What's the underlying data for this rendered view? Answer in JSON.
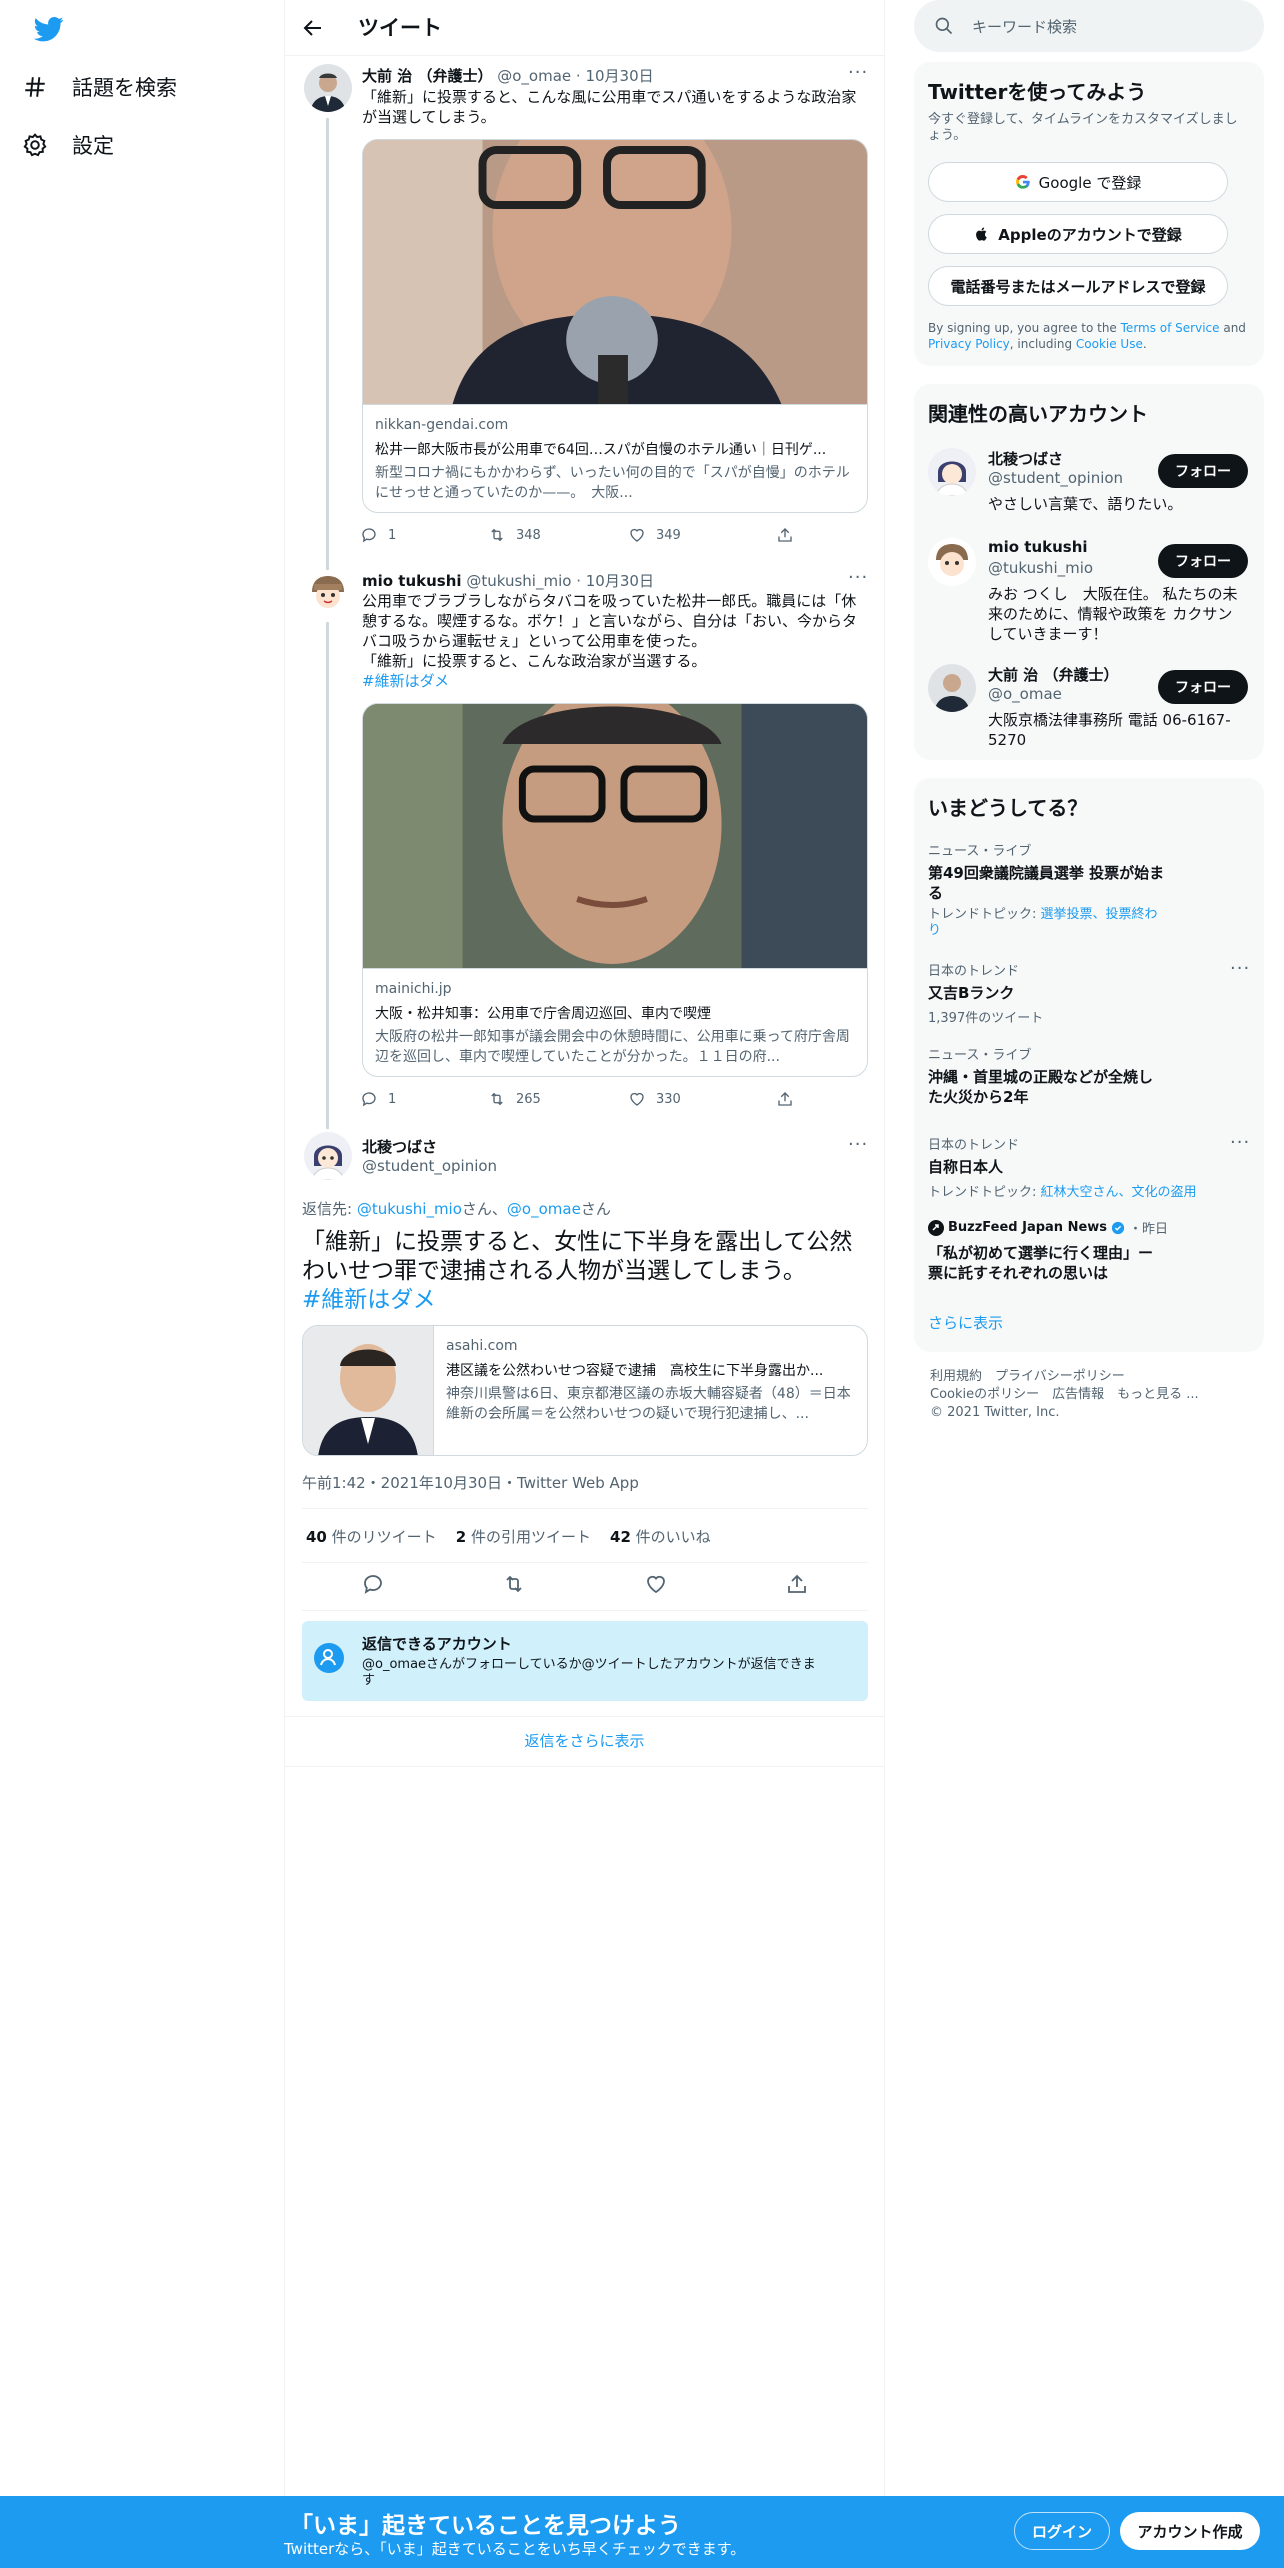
{
  "nav": {
    "explore_label": "話題を検索",
    "settings_label": "設定"
  },
  "header": {
    "title": "ツイート"
  },
  "thread": [
    {
      "name": "大前 治 （弁護士）",
      "handle": "@o_omae",
      "date": "10月30日",
      "text_lines": [
        "「維新」に投票すると、こんな風に公用車でスパ通いをするような政治家",
        "が当選してしまう。"
      ],
      "card_domain": "nikkan-gendai.com",
      "card_title": "松井一郎大阪市長が公用車で64回…スパが自慢のホテル通い｜日刊ゲ...",
      "card_desc": "新型コロナ禍にもかかわらず、いったい何の目的で「スパが自慢」のホテルにせっせと通っていたのか——。　大阪...",
      "replies": "1",
      "retweets": "348",
      "likes": "349"
    },
    {
      "name": "mio tukushi",
      "handle": "@tukushi_mio",
      "date": "10月30日",
      "text_lines": [
        "公用車でブラブラしながらタバコを吸っていた松井一郎氏。職員には「休",
        "憩するな。喫煙するな。ボケ！」と言いながら、自分は「おい、今からタ",
        "バコ吸うから運転せぇ」といって公用車を使った。",
        "「維新」に投票すると、こんな政治家が当選する。"
      ],
      "hashtag": "#維新はダメ",
      "card_domain": "mainichi.jp",
      "card_title": "大阪・松井知事：公用車で庁舎周辺巡回、車内で喫煙",
      "card_desc": "大阪府の松井一郎知事が議会開会中の休憩時間に、公用車に乗って府庁舎周辺を巡回し、車内で喫煙していたことが分かった。１１日の府...",
      "replies": "1",
      "retweets": "265",
      "likes": "330"
    }
  ],
  "main_tweet": {
    "name": "北稜つばさ",
    "handle": "@student_opinion",
    "reply_prefix": "返信先: ",
    "reply_user1": "@tukushi_mio",
    "reply_san1": "さん、",
    "reply_user2": "@o_omae",
    "reply_san2": "さん",
    "text_line1": "「維新」に投票すると、女性に下半身を露出して公然",
    "text_line2": "わいせつ罪で逮捕される人物が当選してしまう。",
    "hashtag": "#維新はダメ",
    "card_domain": "asahi.com",
    "card_title": "港区議を公然わいせつ容疑で逮捕　高校生に下半身露出か...",
    "card_desc": "神奈川県警は6日、東京都港区議の赤坂大輔容疑者（48）＝日本維新の会所属＝を公然わいせつの疑いで現行犯逮捕し、...",
    "timestamp": "午前1:42・2021年10月30日・Twitter Web App",
    "retweet_count": "40",
    "retweet_label": " 件のリツイート",
    "quote_count": "2",
    "quote_label": " 件の引用ツイート",
    "like_count": "42",
    "like_label": " 件のいいね",
    "reply_restrict_title": "返信できるアカウント",
    "reply_restrict_text1": "@o_omaeさんがフォローしているか@ツイートしたアカウントが返信できま",
    "reply_restrict_text2": "す",
    "show_more_replies": "返信をさらに表示"
  },
  "sidebar": {
    "search_placeholder": "キーワード検索",
    "signup": {
      "title": "Twitterを使ってみよう",
      "subtitle1": "今すぐ登録して、タイムラインをカスタマイズしまし",
      "subtitle2": "ょう。",
      "google_btn": "Google で登録",
      "apple_btn": "Appleのアカウントで登録",
      "phone_btn": "電話番号またはメールアドレスで登録",
      "terms_prefix": "By signing up, you agree to the ",
      "terms_link": "Terms of Service",
      "terms_and": " and",
      "privacy_link": "Privacy Policy",
      "terms_including": ", including ",
      "cookie_link": "Cookie Use",
      "terms_end": "."
    },
    "related": {
      "title": "関連性の高いアカウント",
      "follow_label": "フォロー",
      "accounts": [
        {
          "name": "北稜つばさ",
          "handle": "@student_opinion",
          "bio1": "やさしい言葉で、語りたい。",
          "bio2": "",
          "bio3": ""
        },
        {
          "name": "mio tukushi",
          "handle": "@tukushi_mio",
          "bio1": "みお つくし　大阪在住。 私たちの未",
          "bio2": "来のために、情報や政策を カクサン",
          "bio3": "していきまーす！"
        },
        {
          "name": "大前 治 （弁護士）",
          "handle": "@o_omae",
          "bio1": "大阪京橋法律事務所 電話 06-6167-",
          "bio2": "5270",
          "bio3": ""
        }
      ]
    },
    "trends": {
      "title": "いまどうしてる？",
      "items": [
        {
          "meta": "ニュース・ライブ",
          "name1": "第49回衆議院議員選挙 投票が始ま",
          "name2": "る",
          "topic_label": "トレンドトピック: ",
          "topic1": "選挙投票、投票終わ",
          "topic2": "り"
        },
        {
          "meta": "日本のトレンド",
          "name1": "又吉Bランク",
          "count": "1,397件のツイート"
        },
        {
          "meta": "ニュース・ライブ",
          "name1": "沖縄・首里城の正殿などが全焼し",
          "name2": "た火災から2年"
        },
        {
          "meta": "日本のトレンド",
          "name1": "自称日本人",
          "topic_label": "トレンドトピック: ",
          "topic1": "紅林大空さん、文化の盗用"
        },
        {
          "source": "BuzzFeed Japan News",
          "when": "・昨日",
          "name1": "「私が初めて選挙に行く理由」ー",
          "name2": "票に託すそれぞれの思いは"
        }
      ],
      "show_more": "さらに表示"
    },
    "footer": {
      "line1": "利用規約　プライバシーポリシー",
      "line2": "Cookieのポリシー　広告情報　もっと見る ...",
      "copyright": "© 2021 Twitter, Inc."
    }
  },
  "bottom_bar": {
    "title": "「いま」起きていることを見つけよう",
    "subtitle": "Twitterなら、「いま」起きていることをいち早くチェックできます。",
    "login": "ログイン",
    "signup": "アカウント作成"
  },
  "colors": {
    "accent": "#1d9bf0",
    "text": "#0f1419",
    "muted": "#536471"
  }
}
